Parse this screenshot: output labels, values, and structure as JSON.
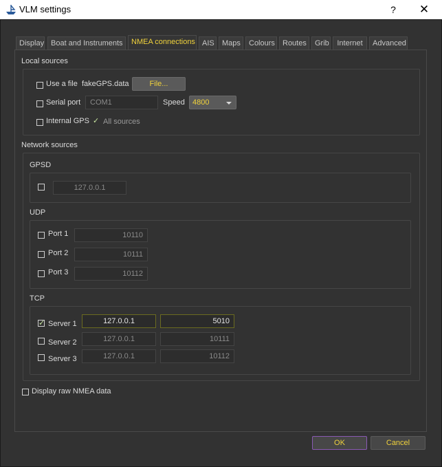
{
  "window": {
    "title": "VLM settings",
    "help": "?",
    "close": "✕"
  },
  "tabs": [
    {
      "label": "Display"
    },
    {
      "label": "Boat and Instruments"
    },
    {
      "label": "NMEA connections"
    },
    {
      "label": "AIS"
    },
    {
      "label": "Maps"
    },
    {
      "label": "Colours"
    },
    {
      "label": "Routes"
    },
    {
      "label": "Grib"
    },
    {
      "label": "Internet"
    },
    {
      "label": "Advanced"
    }
  ],
  "local": {
    "heading": "Local sources",
    "use_file_label": "Use a file",
    "file_name": "fakeGPS.data",
    "file_button": "File...",
    "serial_label": "Serial port",
    "serial_port": "COM1",
    "speed_label": "Speed",
    "speed_value": "4800",
    "internal_gps_label": "Internal GPS",
    "all_sources_label": "All sources"
  },
  "network": {
    "heading": "Network sources",
    "gpsd": {
      "heading": "GPSD",
      "host": "127.0.0.1"
    },
    "udp": {
      "heading": "UDP",
      "ports": [
        {
          "label": "Port 1",
          "value": "10110"
        },
        {
          "label": "Port 2",
          "value": "10111"
        },
        {
          "label": "Port 3",
          "value": "10112"
        }
      ]
    },
    "tcp": {
      "heading": "TCP",
      "servers": [
        {
          "label": "Server 1",
          "host": "127.0.0.1",
          "port": "5010",
          "checked": true
        },
        {
          "label": "Server 2",
          "host": "127.0.0.1",
          "port": "10111",
          "checked": false
        },
        {
          "label": "Server 3",
          "host": "127.0.0.1",
          "port": "10112",
          "checked": false
        }
      ]
    }
  },
  "raw_nmea_label": "Display raw NMEA data",
  "buttons": {
    "ok": "OK",
    "cancel": "Cancel"
  },
  "colors": {
    "accent": "#f0d23c",
    "background": "#323232",
    "ok_border": "#8a5ab4"
  }
}
